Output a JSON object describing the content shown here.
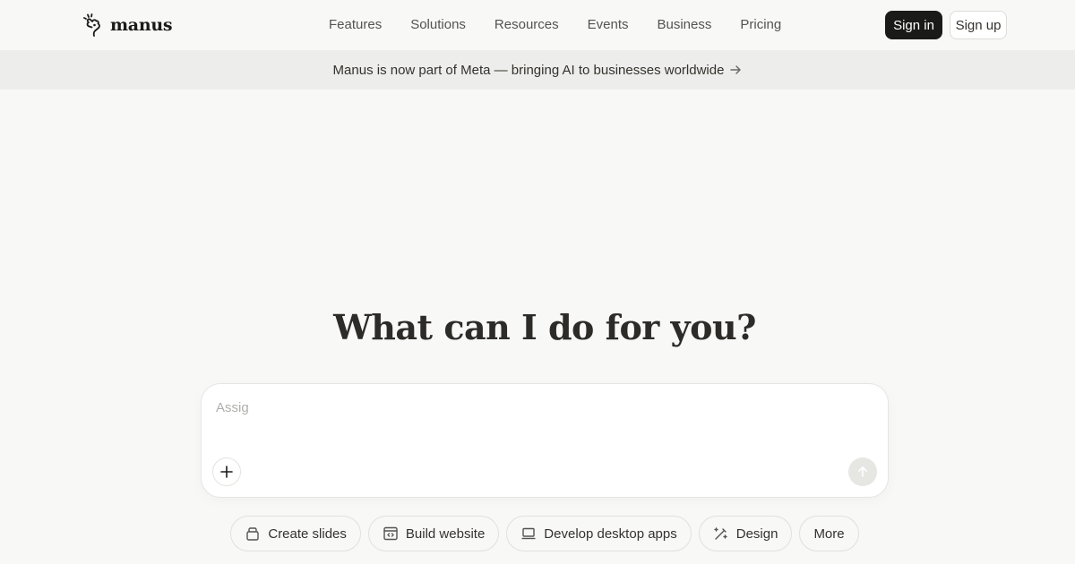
{
  "brand": {
    "name": "manus",
    "logo_icon": "manus-hand-icon"
  },
  "nav": {
    "links": [
      "Features",
      "Solutions",
      "Resources",
      "Events",
      "Business",
      "Pricing"
    ],
    "sign_in": "Sign in",
    "sign_up": "Sign up"
  },
  "banner": {
    "text": "Manus is now part of Meta — bringing AI to businesses worldwide",
    "icon": "arrow-right-icon"
  },
  "hero": {
    "heading": "What can I do for you?"
  },
  "composer": {
    "value": "",
    "placeholder": "Assig",
    "add_icon": "plus-icon",
    "send_icon": "arrow-up-icon"
  },
  "chips": [
    {
      "label": "Create slides",
      "icon": "slides-icon"
    },
    {
      "label": "Build website",
      "icon": "website-icon"
    },
    {
      "label": "Develop desktop apps",
      "icon": "laptop-icon"
    },
    {
      "label": "Design",
      "icon": "design-icon"
    },
    {
      "label": "More",
      "icon": ""
    }
  ],
  "colors": {
    "background": "#f8f8f7",
    "banner": "#ededeb",
    "primary_button": "#1a1a19",
    "text": "#34322d"
  }
}
